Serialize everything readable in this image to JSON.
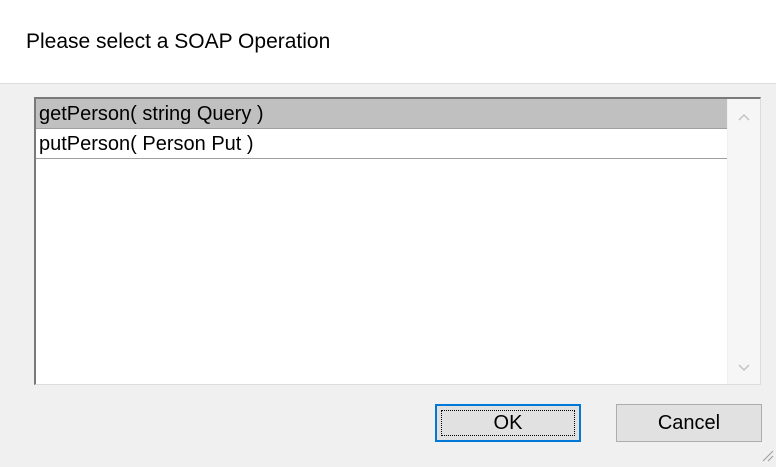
{
  "dialog": {
    "title": "Please select a SOAP Operation"
  },
  "operations": [
    {
      "label": "getPerson( string Query )",
      "selected": true
    },
    {
      "label": "putPerson( Person Put )",
      "selected": false
    }
  ],
  "buttons": {
    "ok_label": "OK",
    "cancel_label": "Cancel"
  },
  "icons": {
    "scroll_up": "chevron-up-icon",
    "scroll_down": "chevron-down-icon",
    "resize": "resize-grip-icon"
  },
  "colors": {
    "selection": "#c0c0c0",
    "focus_border": "#0078d7",
    "dialog_background": "#f0f0f0"
  }
}
